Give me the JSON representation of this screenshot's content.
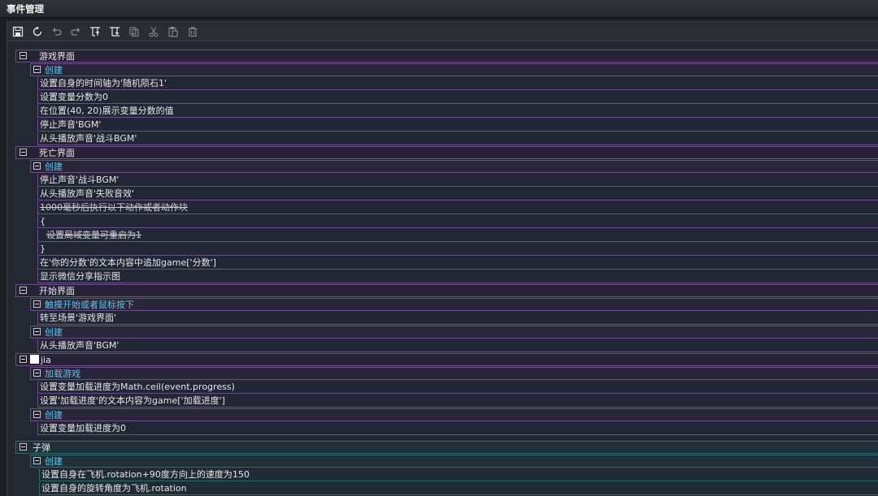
{
  "window": {
    "title": "事件管理"
  },
  "toolbar": {
    "icons": [
      "save-icon",
      "refresh-icon",
      "undo-icon",
      "redo-icon",
      "insert-above-icon",
      "insert-below-icon",
      "copy-icon",
      "cut-icon",
      "paste-icon",
      "delete-icon"
    ]
  },
  "tree": {
    "g1": {
      "label": "游戏界面"
    },
    "g1e1": {
      "label": "创建"
    },
    "g1a1": "设置自身的时间轴为'随机陨石1'",
    "g1a2": "设置变量分数为0",
    "g1a3": "在位置(40, 20)展示变量分数的值",
    "g1a4": "停止声音'BGM'",
    "g1a5": "从头播放声音'战斗BGM'",
    "g2": {
      "label": "死亡界面"
    },
    "g2e1": {
      "label": "创建"
    },
    "g2a1": "停止声音'战斗BGM'",
    "g2a2": "从头播放声音'失败音效'",
    "g2a3": "1000毫秒后执行以下动作或者动作块",
    "g2a4": "{",
    "g2a5": "设置局域变量可重启为1",
    "g2a6": "}",
    "g2a7": "在'你的分数'的文本内容中追加game['分数']",
    "g2a8": "显示微信分享指示图",
    "g3": {
      "label": "开始界面"
    },
    "g3e1": {
      "label": "触摸开始或者鼠标按下"
    },
    "g3a1": "转至场景'游戏界面'",
    "g3e2": {
      "label": "创建"
    },
    "g3a2": "从头播放声音'BGM'",
    "g4": {
      "label": "jia"
    },
    "g4e1": {
      "label": "加载游戏"
    },
    "g4a1": "设置变量加载进度为Math.ceil(event.progress)",
    "g4a2": "设置'加载进度'的文本内容为game['加载进度']",
    "g4e2": {
      "label": "创建"
    },
    "g4a3": "设置变量加载进度为0",
    "g5": {
      "label": "子弹"
    },
    "g5e1": {
      "label": "创建"
    },
    "g5a1": "设置自身在飞机.rotation+90度方向上的速度为150",
    "g5a2": "设置自身的旋转角度为飞机.rotation"
  }
}
